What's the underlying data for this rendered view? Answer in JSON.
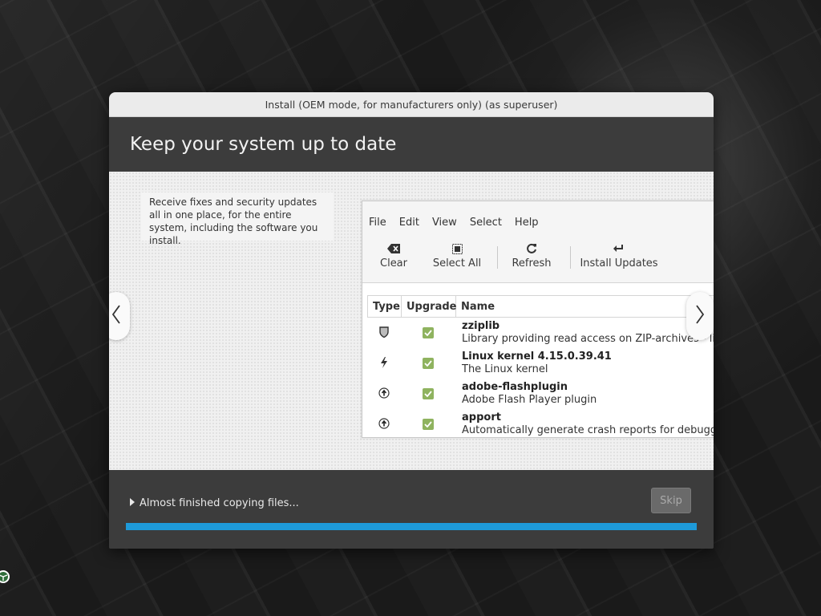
{
  "window": {
    "title": "Install (OEM mode, for manufacturers only) (as superuser)"
  },
  "header": {
    "title": "Keep your system up to date"
  },
  "slide": {
    "description": "Receive fixes and security updates all in one place, for the entire system, including the software you install.",
    "screenshot": {
      "menu": [
        "File",
        "Edit",
        "View",
        "Select",
        "Help"
      ],
      "toolbar": {
        "clear": "Clear",
        "select_all": "Select All",
        "refresh": "Refresh",
        "install_updates": "Install Updates"
      },
      "columns": {
        "type": "Type",
        "upgrade": "Upgrade",
        "name": "Name"
      },
      "rows": [
        {
          "type_icon": "shield-icon",
          "name": "zziplib",
          "description": "Library providing read access on ZIP-archives - library"
        },
        {
          "type_icon": "lightning-icon",
          "name": "Linux kernel 4.15.0.39.41",
          "description": "The Linux kernel"
        },
        {
          "type_icon": "up-arrow-icon",
          "name": "adobe-flashplugin",
          "description": "Adobe Flash Player plugin"
        },
        {
          "type_icon": "up-arrow-icon",
          "name": "apport",
          "description": "Automatically generate crash reports for debugging"
        }
      ]
    }
  },
  "footer": {
    "status": "Almost finished copying files...",
    "skip_label": "Skip",
    "progress": 1.0
  },
  "colors": {
    "accent": "#1e9ad9",
    "header_bg": "#3c3c3c",
    "check_green": "#8fb35f"
  }
}
